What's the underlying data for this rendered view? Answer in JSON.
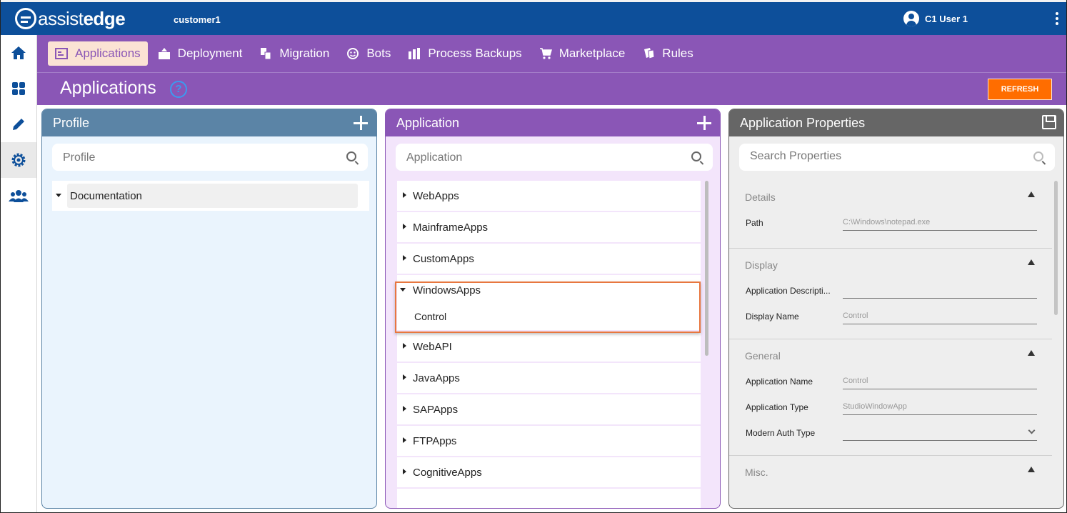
{
  "header": {
    "logo_a": "assist",
    "logo_b": "edge",
    "tenant": "customer1",
    "user": "C1 User 1"
  },
  "nav": {
    "items": [
      {
        "label": "Applications",
        "icon": "applications-icon",
        "active": true
      },
      {
        "label": "Deployment",
        "icon": "deployment-icon",
        "active": false
      },
      {
        "label": "Migration",
        "icon": "migration-icon",
        "active": false
      },
      {
        "label": "Bots",
        "icon": "bots-icon",
        "active": false
      },
      {
        "label": "Process Backups",
        "icon": "process-backups-icon",
        "active": false
      },
      {
        "label": "Marketplace",
        "icon": "marketplace-icon",
        "active": false
      },
      {
        "label": "Rules",
        "icon": "rules-icon",
        "active": false
      }
    ]
  },
  "page": {
    "title": "Applications",
    "help": "?",
    "refresh_label": "REFRESH"
  },
  "profile_panel": {
    "title": "Profile",
    "search_placeholder": "Profile",
    "tree": [
      "Documentation"
    ]
  },
  "app_panel": {
    "title": "Application",
    "search_placeholder": "Application",
    "items": [
      {
        "label": "WebApps"
      },
      {
        "label": "MainframeApps"
      },
      {
        "label": "CustomApps"
      },
      {
        "label": "WindowsApps",
        "expanded": true,
        "children": [
          "Control"
        ]
      },
      {
        "label": "WebAPI"
      },
      {
        "label": "JavaApps"
      },
      {
        "label": "SAPApps"
      },
      {
        "label": "FTPApps"
      },
      {
        "label": "CognitiveApps"
      }
    ]
  },
  "props_panel": {
    "title": "Application Properties",
    "search_placeholder": "Search Properties",
    "sections": {
      "details": {
        "title": "Details",
        "path_label": "Path",
        "path_value": "C:\\Windows\\notepad.exe"
      },
      "display": {
        "title": "Display",
        "desc_label": "Application Descripti...",
        "desc_value": "",
        "name_label": "Display Name",
        "name_value": "Control"
      },
      "general": {
        "title": "General",
        "app_name_label": "Application Name",
        "app_name_value": "Control",
        "app_type_label": "Application Type",
        "app_type_value": "StudioWindowApp",
        "auth_label": "Modern Auth Type",
        "auth_value": ""
      },
      "misc": {
        "title": "Misc."
      }
    }
  },
  "colors": {
    "header_blue": "#0d4f9a",
    "nav_purple": "#8a56b6",
    "refresh_orange": "#ff6d00",
    "profile_head": "#5b84a6",
    "props_head": "#666666",
    "highlight": "#e8773f"
  }
}
